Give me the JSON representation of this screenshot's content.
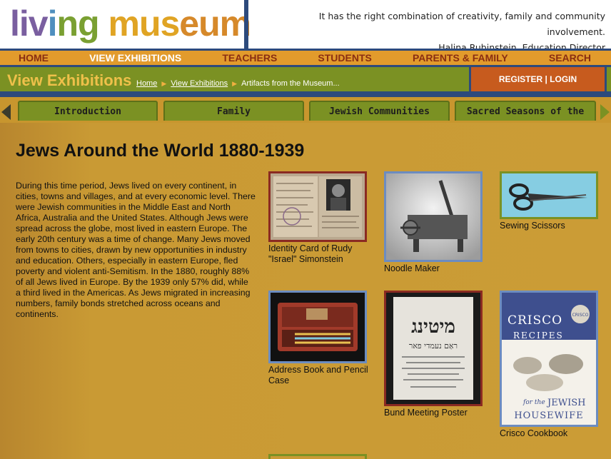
{
  "header": {
    "logo": {
      "part1": "liv",
      "part2": "i",
      "part3": "ng",
      "part4": " mus",
      "part5": "eum"
    },
    "quote": "It has the right combination of creativity, family and community involvement.",
    "attribution": "Halina Rubinstein, Education Director"
  },
  "nav": {
    "items": [
      {
        "label": "HOME"
      },
      {
        "label": "VIEW EXHIBITIONS"
      },
      {
        "label": "TEACHERS"
      },
      {
        "label": "STUDENTS"
      },
      {
        "label": "PARENTS & FAMILY"
      },
      {
        "label": "SEARCH"
      }
    ]
  },
  "titlebar": {
    "title": "View Exhibitions",
    "breadcrumb": [
      "Home",
      "View Exhibitions",
      "Artifacts from the Museum..."
    ],
    "register_login": "REGISTER | LOGIN"
  },
  "tabs": [
    {
      "label": "Introduction"
    },
    {
      "label": "Family"
    },
    {
      "label": "Jewish Communities"
    },
    {
      "label": "Sacred Seasons of the J..."
    }
  ],
  "main": {
    "title": "Jews Around the World 1880-1939",
    "intro": "During this time period, Jews lived on every continent, in cities, towns and villages, and at every economic level. There were Jewish communities in the Middle East and North Africa, Australia and the United States. Although Jews were spread across the globe, most lived in eastern Europe. The early 20th century was a time of change. Many Jews moved from towns to cities, drawn by new opportunities in industry and education. Others, especially in eastern Europe, fled poverty and violent anti-Semitism. In the 1880, roughly 88% of all Jews lived in Europe. By the 1939 only 57% did, while a third lived in the Americas. As Jews migrated in increasing numbers, family bonds stretched across oceans and continents."
  },
  "artifacts": [
    {
      "caption": "Identity Card of Rudy \"Israel\" Simonstein"
    },
    {
      "caption": "Noodle Maker"
    },
    {
      "caption": "Sewing Scissors"
    },
    {
      "caption": "Address Book and Pencil Case"
    },
    {
      "caption": "Bund Meeting Poster"
    },
    {
      "caption": "Crisco Cookbook"
    }
  ],
  "poster_text": {
    "line1": "מיטינג",
    "line2": "ראַם נעמדי פאר"
  },
  "crisco": {
    "title": "CRISCO",
    "subtitle": "RECIPES",
    "badge": "CRISCO",
    "for_the": "for the",
    "jewish": "JEWISH",
    "housewife": "HOUSEWIFE"
  },
  "colors": {
    "navy": "#2d4a7c",
    "green": "#7b9123",
    "orange": "#e29b2c",
    "gold_bg": "#c8962e",
    "nav_text": "#8a2e12",
    "register_bg": "#c75b1e"
  }
}
